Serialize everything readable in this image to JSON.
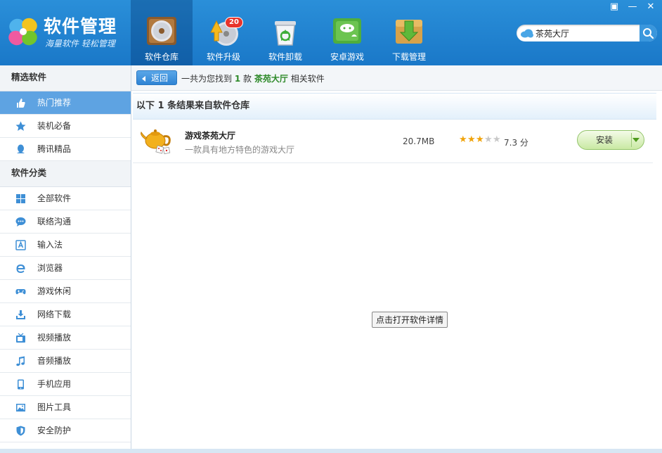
{
  "app": {
    "title": "软件管理",
    "slogan": "海量软件 轻松管理"
  },
  "window_controls": [
    "▣",
    "—",
    "✕"
  ],
  "nav": {
    "items": [
      {
        "label": "软件仓库",
        "icon": "disc-box-icon",
        "active": true
      },
      {
        "label": "软件升级",
        "icon": "upgrade-disc-icon",
        "badge": "20"
      },
      {
        "label": "软件卸载",
        "icon": "recycle-bin-icon"
      },
      {
        "label": "安卓游戏",
        "icon": "android-game-icon"
      },
      {
        "label": "下载管理",
        "icon": "download-box-icon"
      }
    ]
  },
  "search": {
    "value": "茶苑大厅"
  },
  "sidebar": {
    "section_featured": "精选软件",
    "featured": [
      {
        "label": "热门推荐",
        "icon": "thumbs-up-icon",
        "active": true
      },
      {
        "label": "装机必备",
        "icon": "star-icon"
      },
      {
        "label": "腾讯精品",
        "icon": "penguin-icon"
      }
    ],
    "section_categories": "软件分类",
    "categories": [
      {
        "label": "全部软件",
        "icon": "grid-icon"
      },
      {
        "label": "联络沟通",
        "icon": "chat-bubble-icon"
      },
      {
        "label": "输入法",
        "icon": "keyboard-a-icon"
      },
      {
        "label": "浏览器",
        "icon": "browser-e-icon"
      },
      {
        "label": "游戏休闲",
        "icon": "gamepad-icon"
      },
      {
        "label": "网络下载",
        "icon": "download-tray-icon"
      },
      {
        "label": "视频播放",
        "icon": "tv-icon"
      },
      {
        "label": "音频播放",
        "icon": "music-note-icon"
      },
      {
        "label": "手机应用",
        "icon": "phone-icon"
      },
      {
        "label": "图片工具",
        "icon": "picture-icon"
      },
      {
        "label": "安全防护",
        "icon": "shield-icon"
      }
    ]
  },
  "toolbar": {
    "back_label": "返回",
    "summary_prefix": "一共为您找到",
    "summary_count": "1",
    "summary_unit": "款",
    "summary_keyword": "茶苑大厅",
    "summary_suffix": "相关软件"
  },
  "results": {
    "header": "以下 1 条结果来自软件仓库",
    "items": [
      {
        "name": "游戏茶苑大厅",
        "description": "一款具有地方特色的游戏大厅",
        "size": "20.7MB",
        "rating_stars": 3,
        "rating_max": 5,
        "score": "7.3 分",
        "install_label": "安装",
        "icon": "teapot-icon"
      }
    ]
  },
  "tooltip": "点击打开软件详情",
  "colors": {
    "header_blue": "#1f82cf",
    "sidebar_active": "#5ea3e2",
    "highlight_green": "#2f8a2a",
    "star_gold": "#f0a30a"
  }
}
